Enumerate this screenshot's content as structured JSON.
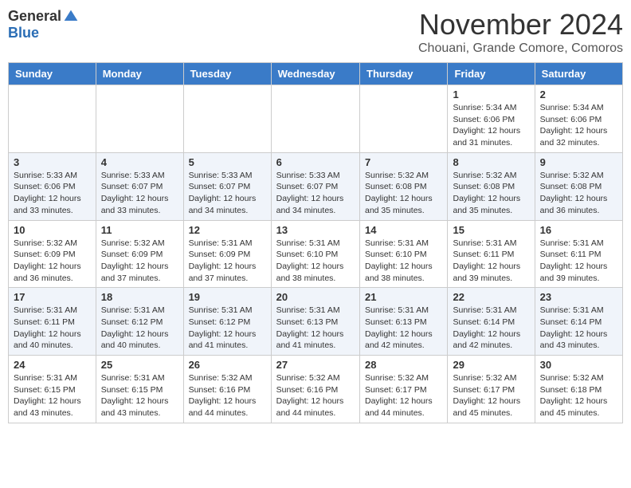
{
  "header": {
    "logo_general": "General",
    "logo_blue": "Blue",
    "month_title": "November 2024",
    "location": "Chouani, Grande Comore, Comoros"
  },
  "days_of_week": [
    "Sunday",
    "Monday",
    "Tuesday",
    "Wednesday",
    "Thursday",
    "Friday",
    "Saturday"
  ],
  "weeks": [
    [
      {
        "day": "",
        "info": ""
      },
      {
        "day": "",
        "info": ""
      },
      {
        "day": "",
        "info": ""
      },
      {
        "day": "",
        "info": ""
      },
      {
        "day": "",
        "info": ""
      },
      {
        "day": "1",
        "info": "Sunrise: 5:34 AM\nSunset: 6:06 PM\nDaylight: 12 hours and 31 minutes."
      },
      {
        "day": "2",
        "info": "Sunrise: 5:34 AM\nSunset: 6:06 PM\nDaylight: 12 hours and 32 minutes."
      }
    ],
    [
      {
        "day": "3",
        "info": "Sunrise: 5:33 AM\nSunset: 6:06 PM\nDaylight: 12 hours and 33 minutes."
      },
      {
        "day": "4",
        "info": "Sunrise: 5:33 AM\nSunset: 6:07 PM\nDaylight: 12 hours and 33 minutes."
      },
      {
        "day": "5",
        "info": "Sunrise: 5:33 AM\nSunset: 6:07 PM\nDaylight: 12 hours and 34 minutes."
      },
      {
        "day": "6",
        "info": "Sunrise: 5:33 AM\nSunset: 6:07 PM\nDaylight: 12 hours and 34 minutes."
      },
      {
        "day": "7",
        "info": "Sunrise: 5:32 AM\nSunset: 6:08 PM\nDaylight: 12 hours and 35 minutes."
      },
      {
        "day": "8",
        "info": "Sunrise: 5:32 AM\nSunset: 6:08 PM\nDaylight: 12 hours and 35 minutes."
      },
      {
        "day": "9",
        "info": "Sunrise: 5:32 AM\nSunset: 6:08 PM\nDaylight: 12 hours and 36 minutes."
      }
    ],
    [
      {
        "day": "10",
        "info": "Sunrise: 5:32 AM\nSunset: 6:09 PM\nDaylight: 12 hours and 36 minutes."
      },
      {
        "day": "11",
        "info": "Sunrise: 5:32 AM\nSunset: 6:09 PM\nDaylight: 12 hours and 37 minutes."
      },
      {
        "day": "12",
        "info": "Sunrise: 5:31 AM\nSunset: 6:09 PM\nDaylight: 12 hours and 37 minutes."
      },
      {
        "day": "13",
        "info": "Sunrise: 5:31 AM\nSunset: 6:10 PM\nDaylight: 12 hours and 38 minutes."
      },
      {
        "day": "14",
        "info": "Sunrise: 5:31 AM\nSunset: 6:10 PM\nDaylight: 12 hours and 38 minutes."
      },
      {
        "day": "15",
        "info": "Sunrise: 5:31 AM\nSunset: 6:11 PM\nDaylight: 12 hours and 39 minutes."
      },
      {
        "day": "16",
        "info": "Sunrise: 5:31 AM\nSunset: 6:11 PM\nDaylight: 12 hours and 39 minutes."
      }
    ],
    [
      {
        "day": "17",
        "info": "Sunrise: 5:31 AM\nSunset: 6:11 PM\nDaylight: 12 hours and 40 minutes."
      },
      {
        "day": "18",
        "info": "Sunrise: 5:31 AM\nSunset: 6:12 PM\nDaylight: 12 hours and 40 minutes."
      },
      {
        "day": "19",
        "info": "Sunrise: 5:31 AM\nSunset: 6:12 PM\nDaylight: 12 hours and 41 minutes."
      },
      {
        "day": "20",
        "info": "Sunrise: 5:31 AM\nSunset: 6:13 PM\nDaylight: 12 hours and 41 minutes."
      },
      {
        "day": "21",
        "info": "Sunrise: 5:31 AM\nSunset: 6:13 PM\nDaylight: 12 hours and 42 minutes."
      },
      {
        "day": "22",
        "info": "Sunrise: 5:31 AM\nSunset: 6:14 PM\nDaylight: 12 hours and 42 minutes."
      },
      {
        "day": "23",
        "info": "Sunrise: 5:31 AM\nSunset: 6:14 PM\nDaylight: 12 hours and 43 minutes."
      }
    ],
    [
      {
        "day": "24",
        "info": "Sunrise: 5:31 AM\nSunset: 6:15 PM\nDaylight: 12 hours and 43 minutes."
      },
      {
        "day": "25",
        "info": "Sunrise: 5:31 AM\nSunset: 6:15 PM\nDaylight: 12 hours and 43 minutes."
      },
      {
        "day": "26",
        "info": "Sunrise: 5:32 AM\nSunset: 6:16 PM\nDaylight: 12 hours and 44 minutes."
      },
      {
        "day": "27",
        "info": "Sunrise: 5:32 AM\nSunset: 6:16 PM\nDaylight: 12 hours and 44 minutes."
      },
      {
        "day": "28",
        "info": "Sunrise: 5:32 AM\nSunset: 6:17 PM\nDaylight: 12 hours and 44 minutes."
      },
      {
        "day": "29",
        "info": "Sunrise: 5:32 AM\nSunset: 6:17 PM\nDaylight: 12 hours and 45 minutes."
      },
      {
        "day": "30",
        "info": "Sunrise: 5:32 AM\nSunset: 6:18 PM\nDaylight: 12 hours and 45 minutes."
      }
    ]
  ]
}
